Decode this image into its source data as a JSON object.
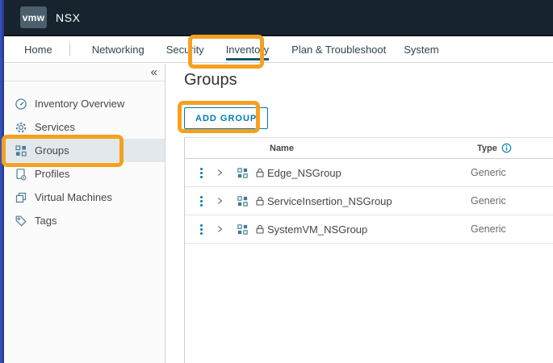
{
  "header": {
    "logo": "vmw",
    "product": "NSX"
  },
  "nav": {
    "items": [
      {
        "label": "Home",
        "active": false
      },
      {
        "label": "Networking",
        "active": false
      },
      {
        "label": "Security",
        "active": false
      },
      {
        "label": "Inventory",
        "active": true
      },
      {
        "label": "Plan & Troubleshoot",
        "active": false
      },
      {
        "label": "System",
        "active": false
      }
    ]
  },
  "sidebar": {
    "collapse_icon": "«",
    "items": [
      {
        "label": "Inventory Overview",
        "icon": "gauge-icon",
        "selected": false
      },
      {
        "label": "Services",
        "icon": "gear-icon",
        "selected": false
      },
      {
        "label": "Groups",
        "icon": "groups-grid-icon",
        "selected": true
      },
      {
        "label": "Profiles",
        "icon": "profile-document-icon",
        "selected": false
      },
      {
        "label": "Virtual Machines",
        "icon": "virtual-machine-icon",
        "selected": false
      },
      {
        "label": "Tags",
        "icon": "tag-icon",
        "selected": false
      }
    ]
  },
  "main": {
    "title": "Groups",
    "add_button_label": "ADD GROUP",
    "table": {
      "columns": [
        {
          "label": "Name",
          "info": false
        },
        {
          "label": "Type",
          "info": true
        }
      ],
      "rows": [
        {
          "name": "Edge_NSGroup",
          "type": "Generic",
          "locked": true
        },
        {
          "name": "ServiceInsertion_NSGroup",
          "type": "Generic",
          "locked": true
        },
        {
          "name": "SystemVM_NSGroup",
          "type": "Generic",
          "locked": true
        }
      ]
    }
  },
  "annotations": {
    "highlight_color": "#f5a01e",
    "highlighted_elements": [
      "inventory-nav-tab",
      "groups-sidebar-item",
      "add-group-button"
    ]
  },
  "colors": {
    "topbar_bg": "#17242f",
    "accent_blue": "#0079b8",
    "active_tab_underline": "#19586f",
    "sidebar_selected_bg": "#e2e8eb"
  }
}
